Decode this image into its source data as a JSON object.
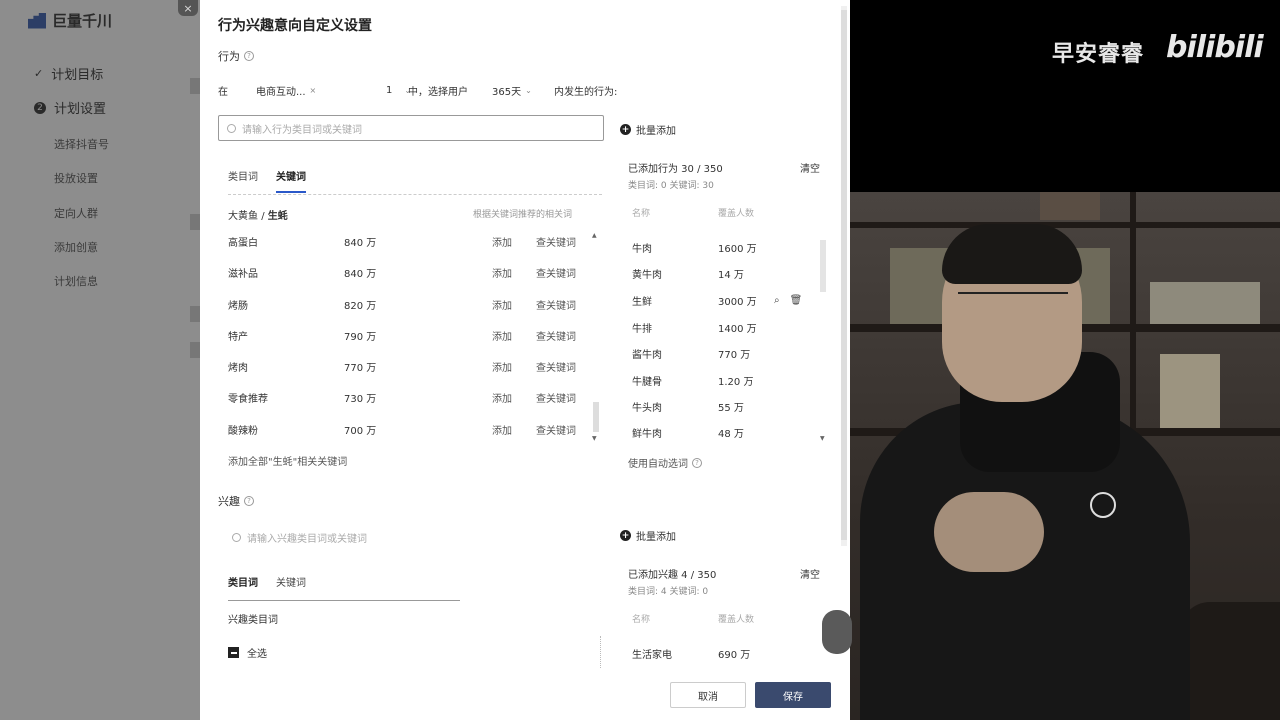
{
  "sidebar": {
    "logo": "巨量千川",
    "close": "×",
    "steps": [
      {
        "label": "计划目标",
        "icon": "✓"
      },
      {
        "label": "计划设置",
        "icon": "2"
      }
    ],
    "sub_items": [
      "选择抖音号",
      "投放设置",
      "定向人群",
      "添加创意",
      "计划信息"
    ]
  },
  "modal": {
    "title": "行为兴趣意向自定义设置",
    "behavior": {
      "label": "行为",
      "cond_in": "在",
      "scene": "电商互动...",
      "scene_close": "×",
      "num": "1",
      "middle": "中，选择用户",
      "days": "365天",
      "tail": "内发生的行为:",
      "search_placeholder": "请输入行为类目词或关键词",
      "batch_add": "批量添加",
      "tabs": [
        "类目词",
        "关键词"
      ],
      "crumb_parent": "大黄鱼",
      "crumb_sep": "/",
      "crumb_current": "生蚝",
      "crumb_hint": "根据关键词推荐的相关词",
      "keywords": [
        {
          "name": "高蛋白",
          "count": "840 万"
        },
        {
          "name": "滋补品",
          "count": "840 万"
        },
        {
          "name": "烤肠",
          "count": "820 万"
        },
        {
          "name": "特产",
          "count": "790 万"
        },
        {
          "name": "烤肉",
          "count": "770 万"
        },
        {
          "name": "零食推荐",
          "count": "730 万"
        },
        {
          "name": "酸辣粉",
          "count": "700 万"
        }
      ],
      "add_label": "添加",
      "look_label": "查关键词",
      "add_all": "添加全部\"生蚝\"相关关键词",
      "added_title": "已添加行为 30 / 350",
      "added_sub": "类目词: 0   关键词: 30",
      "clear": "清空",
      "col_word": "名称",
      "col_cover": "覆盖人数",
      "added": [
        {
          "name": "牛肉",
          "count": "1600 万"
        },
        {
          "name": "黄牛肉",
          "count": "14 万"
        },
        {
          "name": "生鲜",
          "count": "3000 万"
        },
        {
          "name": "牛排",
          "count": "1400 万"
        },
        {
          "name": "酱牛肉",
          "count": "770 万"
        },
        {
          "name": "牛腱骨",
          "count": "1.20 万"
        },
        {
          "name": "牛头肉",
          "count": "55 万"
        },
        {
          "name": "鲜牛肉",
          "count": "48 万"
        }
      ],
      "auto_words": "使用自动选词"
    },
    "interest": {
      "label": "兴趣",
      "search_placeholder": "请输入兴趣类目词或关键词",
      "batch_add": "批量添加",
      "tabs": [
        "类目词",
        "关键词"
      ],
      "category_label": "兴趣类目词",
      "select_all": "全选",
      "added_title": "已添加兴趣 4 / 350",
      "added_sub": "类目词: 4   关键词: 0",
      "clear": "清空",
      "col_word": "名称",
      "col_cover": "覆盖人数",
      "added": [
        {
          "name": "生活家电",
          "count": "690 万"
        }
      ]
    },
    "cancel": "取消",
    "save": "保存"
  },
  "overlay": {
    "brand": "早安睿睿",
    "bili": "bilibili"
  }
}
